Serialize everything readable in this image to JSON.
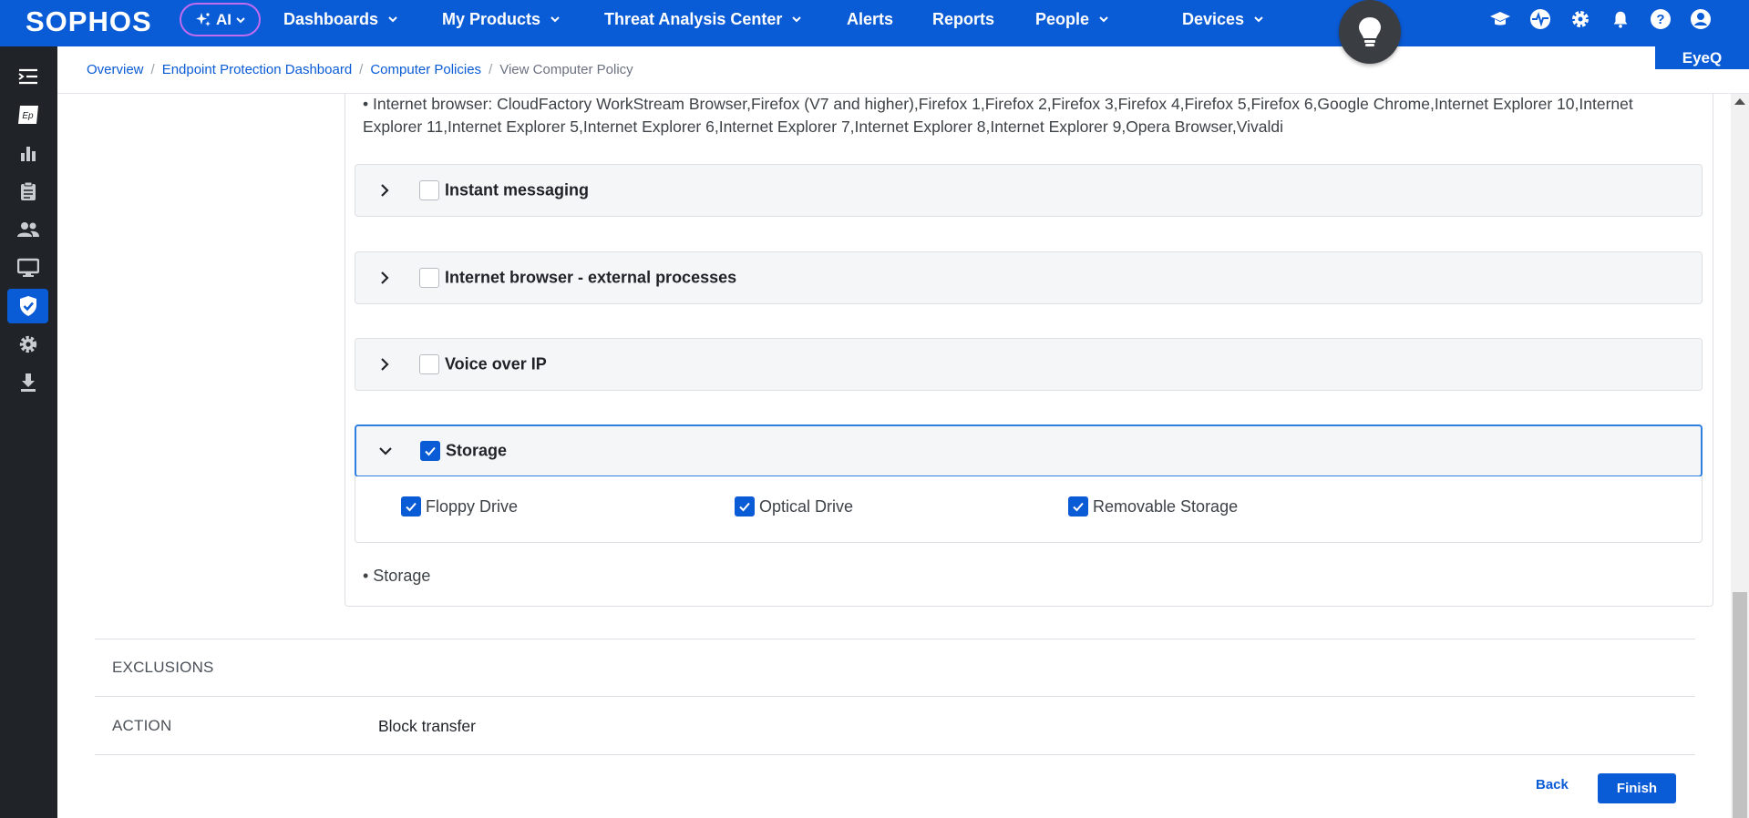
{
  "topbar": {
    "logo": "SOPHOS",
    "ai_label": "AI",
    "nav": [
      {
        "label": "Dashboards",
        "has_menu": true
      },
      {
        "label": "My Products",
        "has_menu": true
      },
      {
        "label": "Threat Analysis Center",
        "has_menu": true
      },
      {
        "label": "Alerts",
        "has_menu": false
      },
      {
        "label": "Reports",
        "has_menu": false
      },
      {
        "label": "People",
        "has_menu": true
      },
      {
        "label": "Devices",
        "has_menu": true
      }
    ],
    "icons": [
      "graduation-cap-icon",
      "pulse-icon",
      "gear-icon",
      "bell-icon",
      "help-icon",
      "user-icon"
    ],
    "eyeq_label": "EyeQ",
    "brand_color": "#0a5bd6"
  },
  "sidebar": {
    "items": [
      "collapse-menu-icon",
      "endpoint-icon",
      "bar-chart-icon",
      "clipboard-icon",
      "people-icon",
      "monitor-icon",
      "shield-check-icon",
      "gear-icon",
      "download-icon"
    ],
    "active": "shield-check-icon",
    "endpoint_badge": "Ep"
  },
  "breadcrumb": {
    "items": [
      "Overview",
      "Endpoint Protection Dashboard",
      "Computer Policies"
    ],
    "current": "View Computer Policy"
  },
  "content": {
    "browser_list": "• Internet browser: CloudFactory WorkStream Browser,Firefox (V7 and higher),Firefox 1,Firefox 2,Firefox 3,Firefox 4,Firefox 5,Firefox 6,Google Chrome,Internet Explorer 10,Internet Explorer 11,Internet Explorer 5,Internet Explorer 6,Internet Explorer 7,Internet Explorer 8,Internet Explorer 9,Opera Browser,Vivaldi",
    "accordions": [
      {
        "label": "Instant messaging",
        "checked": false,
        "expanded": false
      },
      {
        "label": "Internet browser - external processes",
        "checked": false,
        "expanded": false
      },
      {
        "label": "Voice over IP",
        "checked": false,
        "expanded": false
      },
      {
        "label": "Storage",
        "checked": true,
        "expanded": true
      }
    ],
    "storage_options": [
      {
        "label": "Floppy Drive",
        "checked": true
      },
      {
        "label": "Optical Drive",
        "checked": true
      },
      {
        "label": "Removable Storage",
        "checked": true
      }
    ],
    "storage_note": "• Storage"
  },
  "details": {
    "exclusions_label": "EXCLUSIONS",
    "action_label": "ACTION",
    "action_value": "Block transfer"
  },
  "footer": {
    "back_label": "Back",
    "finish_label": "Finish"
  }
}
